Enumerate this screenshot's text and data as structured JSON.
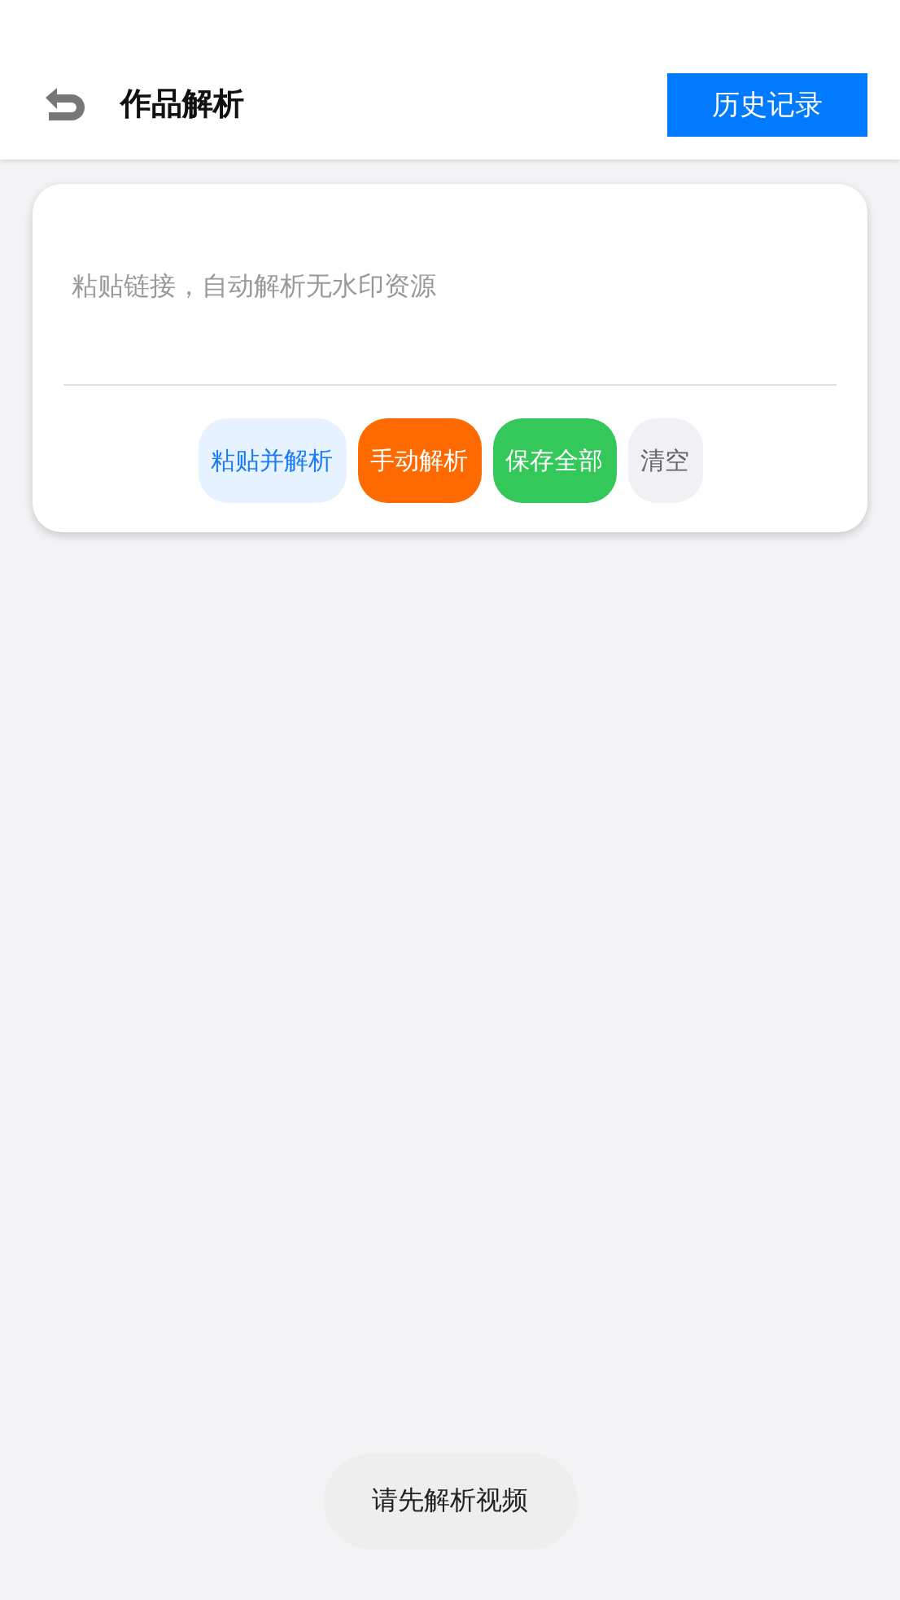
{
  "header": {
    "title": "作品解析",
    "history_button": "历史记录"
  },
  "link_input": {
    "placeholder": "粘贴链接，自动解析无水印资源"
  },
  "actions": [
    {
      "label": "粘贴并解析",
      "kind": "soft"
    },
    {
      "label": "手动解析",
      "kind": "orange"
    },
    {
      "label": "保存全部",
      "kind": "green"
    },
    {
      "label": "清空",
      "kind": "plain"
    }
  ],
  "toast": "请先解析视频"
}
